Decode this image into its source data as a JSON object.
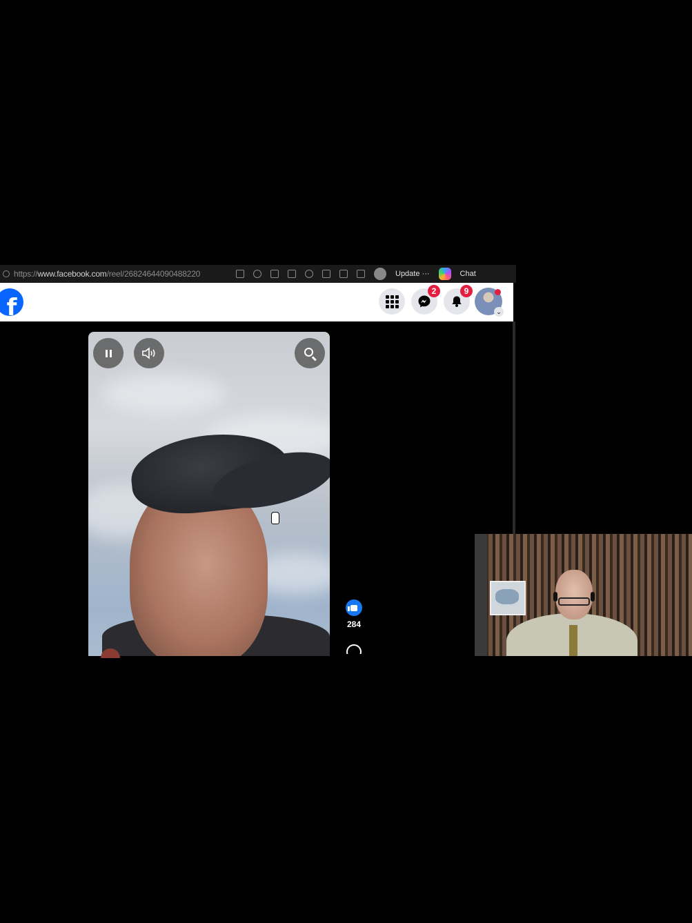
{
  "browser": {
    "url_prefix": "https://",
    "url_host": "www.facebook.com",
    "url_path": "/reel/268246440904882",
    "url_suffix": "20",
    "update_label": "Update",
    "more_label": "···",
    "chat_label": "Chat"
  },
  "facebook": {
    "logo_letter": "f",
    "messenger_badge": "2",
    "notifications_badge": "9",
    "avatar_chevron": "⌄"
  },
  "reel": {
    "like_count": "284"
  },
  "icons": {
    "menu": "grid-icon",
    "messenger": "messenger-icon",
    "notifications": "bell-icon",
    "pause": "pause-icon",
    "volume": "volume-icon",
    "search": "search-icon",
    "like": "like-icon",
    "comment": "comment-icon"
  },
  "colors": {
    "facebook_blue": "#0866ff",
    "badge_red": "#e41e3f",
    "like_blue": "#1877f2"
  }
}
